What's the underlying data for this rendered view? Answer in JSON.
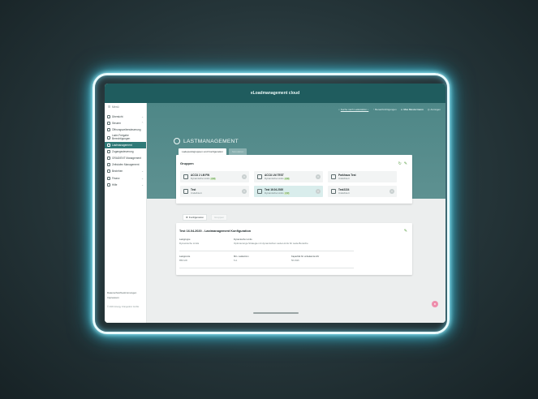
{
  "app": {
    "title": "eLoadmanagement cloud"
  },
  "colors": {
    "header": "#1f5c5e",
    "hero": "#4e8787",
    "accent_green": "#5fa04a",
    "active_nav": "#2f7a78",
    "glow": "#4fd7f0"
  },
  "sidebar": {
    "menu_label": "Menü",
    "items": [
      {
        "label": "Übersicht",
        "icon": "chart-icon",
        "chevron": "v"
      },
      {
        "label": "Steuern",
        "icon": "gear-icon",
        "chevron": "^"
      },
      {
        "label": "Öffnungszeitensteuerung",
        "icon": "clock-icon",
        "chevron": ""
      },
      {
        "label": "Lade-Freigabe Berechtigungen",
        "icon": "lock-icon",
        "chevron": ""
      },
      {
        "label": "Lastmanagement",
        "icon": "load-icon",
        "chevron": "",
        "active": true
      },
      {
        "label": "Zugangssteuerung",
        "icon": "access-icon",
        "chevron": ""
      },
      {
        "label": "GRADIENT Management",
        "icon": "gradient-icon",
        "chevron": ""
      },
      {
        "label": "Zeitstufen Management",
        "icon": "time-icon",
        "chevron": ""
      },
      {
        "label": "Beziehen",
        "icon": "download-icon",
        "chevron": "v"
      },
      {
        "label": "Finanz",
        "icon": "finance-icon",
        "chevron": "v"
      },
      {
        "label": "Hilfe",
        "icon": "help-icon",
        "chevron": "v"
      }
    ],
    "footer": {
      "privacy": "Datenschutzbestimmungen",
      "imprint": "Impressum",
      "copyright": "© 2021 Energy chargedom GmbH"
    }
  },
  "top_actions": [
    {
      "label": "Suche nach Ladestation ↓",
      "icon": "search-icon",
      "underline": true
    },
    {
      "label": "Benachrichtigungen",
      "icon": "bell-icon"
    },
    {
      "label": "Max Mustermann",
      "icon": "user-icon"
    },
    {
      "label": "Anzeigen",
      "icon": "settings-icon"
    }
  ],
  "page": {
    "title": "LASTMANAGEMENT",
    "tabs": [
      {
        "label": "Ladepunktgruppen und Konfiguration",
        "active": true
      },
      {
        "label": "Simulation",
        "active": false
      }
    ]
  },
  "groups": {
    "title": "Gruppen",
    "items": [
      {
        "name": "ACCU 2 LM FW",
        "type": "Dynamische Limits",
        "badge": "(FR)",
        "selected": false
      },
      {
        "name": "ACCU LM TEST",
        "type": "Dynamische Limits",
        "badge": "(FR)",
        "selected": false
      },
      {
        "name": "Parkhaus Test",
        "type": "Undefiniert",
        "badge": "",
        "selected": false
      },
      {
        "name": "Test",
        "type": "Undefiniert",
        "badge": "",
        "selected": false
      },
      {
        "name": "Test 16.04.2020",
        "type": "Dynamische Limits",
        "badge": "(FR)",
        "selected": true
      },
      {
        "name": "Test2224",
        "type": "Undefiniert",
        "badge": "",
        "selected": false
      }
    ]
  },
  "config": {
    "tabs": [
      {
        "label": "Konfiguration",
        "active": true
      },
      {
        "label": "Gruppen",
        "active": false
      }
    ],
    "title": "Test 16.04.2020 - Lastmanagement Konfiguration",
    "fields": {
      "lastgruppe_label": "Lastgruppe",
      "lastgruppe_value": "Dynamische Limits",
      "strategie_label": "Dynamische Limits",
      "strategie_value": "Optimierungs-Strategie mit dynamischen Lade-Limits für Lade-Bereiche",
      "lastgrenze_label": "Lastgrenze",
      "lastgrenze_value": "850 kW",
      "min_label": "Min. Ladestrom",
      "min_value": "6 A",
      "kapazitaet_label": "Kapazität für unbekannte EV",
      "kapazitaet_value": "50 kWh"
    }
  }
}
